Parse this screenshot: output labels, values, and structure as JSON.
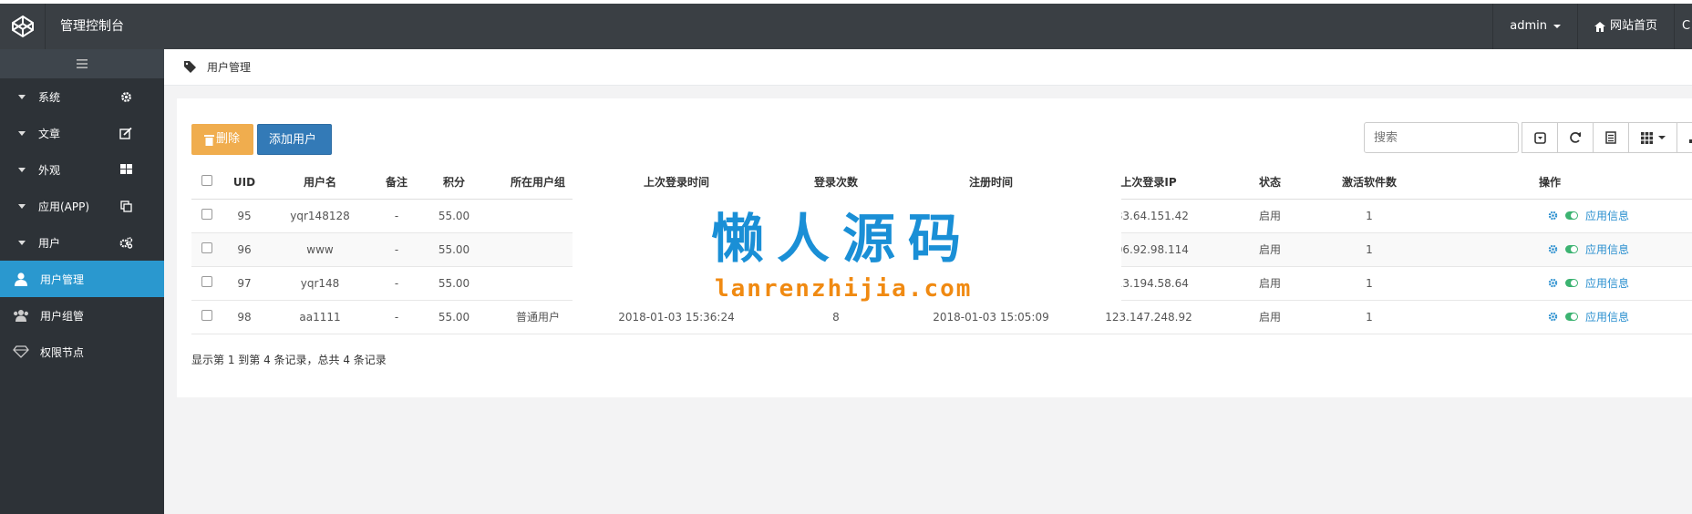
{
  "header": {
    "title": "管理控制台",
    "user": "admin",
    "home_link": "网站首页",
    "overflow": "C"
  },
  "sidebar": {
    "toggle_icon": "hamburger-icon",
    "groups": [
      {
        "label": "系统",
        "icon": "gear-icon"
      },
      {
        "label": "文章",
        "icon": "edit-icon"
      },
      {
        "label": "外观",
        "icon": "grid-icon"
      },
      {
        "label": "应用(APP)",
        "icon": "copy-icon"
      },
      {
        "label": "用户",
        "icon": "gears-icon"
      }
    ],
    "items": [
      {
        "label": "用户管理",
        "icon": "user-icon",
        "active": true
      },
      {
        "label": "用户组管",
        "icon": "users-icon",
        "active": false
      },
      {
        "label": "权限节点",
        "icon": "diamond-icon",
        "active": false
      }
    ]
  },
  "breadcrumb": {
    "label": "用户管理",
    "icon": "tag-icon"
  },
  "toolbar": {
    "delete_label": "删除",
    "add_label": "添加用户",
    "search_placeholder": "搜索"
  },
  "table": {
    "columns": [
      "UID",
      "用户名",
      "备注",
      "积分",
      "所在用户组",
      "上次登录时间",
      "登录次数",
      "注册时间",
      "上次登录IP",
      "状态",
      "激活软件数",
      "操作"
    ],
    "rows": [
      {
        "uid": "95",
        "username": "yqr148128",
        "note": "-",
        "points": "55.00",
        "group": "",
        "last_login": "",
        "login_count": "",
        "reg_time": "",
        "ip": "183.64.151.42",
        "status": "启用",
        "activations": "1",
        "op_label": "应用信息"
      },
      {
        "uid": "96",
        "username": "www",
        "note": "-",
        "points": "55.00",
        "group": "",
        "last_login": "",
        "login_count": "",
        "reg_time": "",
        "ip": "106.92.98.114",
        "status": "启用",
        "activations": "1",
        "op_label": "应用信息"
      },
      {
        "uid": "97",
        "username": "yqr148",
        "note": "-",
        "points": "55.00",
        "group": "",
        "last_login": "",
        "login_count": "",
        "reg_time": "",
        "ip": "113.194.58.64",
        "status": "启用",
        "activations": "1",
        "op_label": "应用信息"
      },
      {
        "uid": "98",
        "username": "aa1111",
        "note": "-",
        "points": "55.00",
        "group": "普通用户",
        "last_login": "2018-01-03 15:36:24",
        "login_count": "8",
        "reg_time": "2018-01-03 15:05:09",
        "ip": "123.147.248.92",
        "status": "启用",
        "activations": "1",
        "op_label": "应用信息"
      }
    ]
  },
  "pagination": {
    "summary": "显示第 1 到第 4 条记录，总共 4 条记录"
  },
  "watermark": {
    "title": "懒人源码",
    "url": "lanrenzhijia.com"
  },
  "colors": {
    "topbar": "#3a3f44",
    "sidebar": "#2d3237",
    "active": "#2a98cf",
    "delete_button": "#f0ad4e",
    "add_button": "#337ab7",
    "watermark_title": "#1a8fd6",
    "watermark_url": "#f08a12"
  }
}
